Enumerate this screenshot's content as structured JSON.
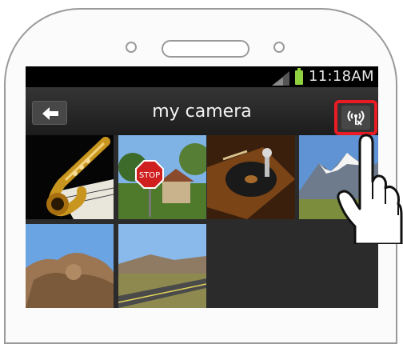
{
  "status_bar": {
    "time": "11:18AM",
    "icons": [
      "signal-icon",
      "battery-icon"
    ]
  },
  "app_bar": {
    "back_icon": "back-arrow-icon",
    "title": "my camera",
    "remote_icon": "remote-shooting-icon"
  },
  "gallery": {
    "thumbnails": [
      "saxophone-photo",
      "stop-sign-photo",
      "phonograph-photo",
      "snowy-mountain-photo",
      "rock-formation-photo",
      "desert-road-photo"
    ]
  },
  "colors": {
    "highlight": "#ea1b23",
    "screen": "#2b2b2b"
  }
}
